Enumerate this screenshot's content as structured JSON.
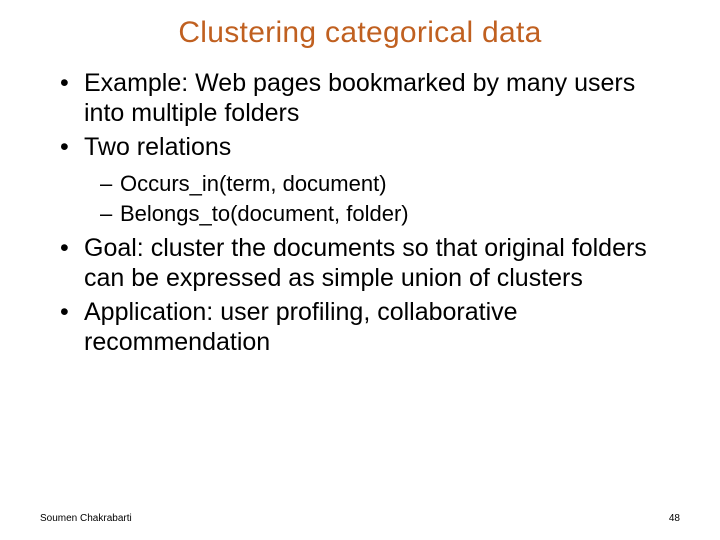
{
  "title": "Clustering categorical data",
  "bullets": {
    "b0": "Example: Web pages bookmarked by many users into multiple folders",
    "b1": "Two relations",
    "b1_sub": {
      "s0": "Occurs_in(term, document)",
      "s1": "Belongs_to(document, folder)"
    },
    "b2": "Goal: cluster the documents so that original folders can be expressed as simple union of clusters",
    "b3": "Application: user profiling, collaborative recommendation"
  },
  "footer": {
    "author": "Soumen Chakrabarti",
    "page": "48"
  }
}
